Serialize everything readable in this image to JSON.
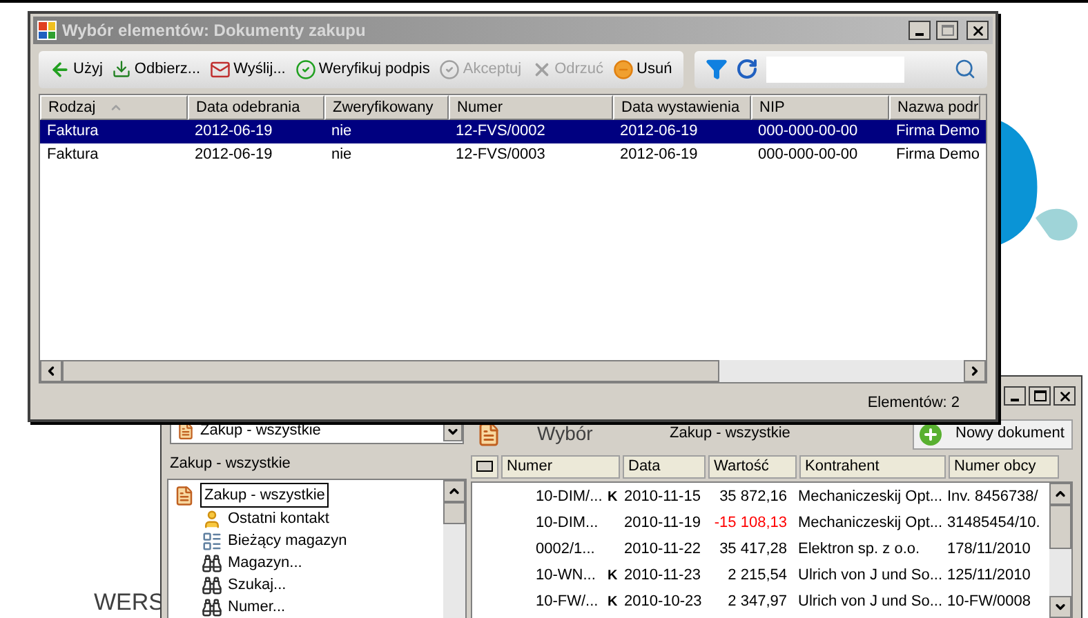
{
  "desktop": {
    "text": "WERS"
  },
  "dialog": {
    "title": "Wybór elementów: Dokumenty zakupu",
    "toolbar": [
      {
        "kind": "use",
        "label": "Użyj",
        "disabled": false
      },
      {
        "kind": "receive",
        "label": "Odbierz...",
        "disabled": false
      },
      {
        "kind": "send",
        "label": "Wyślij...",
        "disabled": false
      },
      {
        "kind": "verify",
        "label": "Weryfikuj podpis",
        "disabled": false
      },
      {
        "kind": "accept",
        "label": "Akceptuj",
        "disabled": true
      },
      {
        "kind": "reject",
        "label": "Odrzuć",
        "disabled": true
      },
      {
        "kind": "delete",
        "label": "Usuń",
        "disabled": false
      }
    ],
    "columns": [
      "Rodzaj",
      "Data odebrania",
      "Zweryfikowany",
      "Numer",
      "Data wystawienia",
      "NIP",
      "Nazwa podr"
    ],
    "rows": [
      {
        "selected": true,
        "cells": [
          "Faktura",
          "2012-06-19",
          "nie",
          "12-FVS/0002",
          "2012-06-19",
          "000-000-00-00",
          "Firma Demo"
        ]
      },
      {
        "selected": false,
        "cells": [
          "Faktura",
          "2012-06-19",
          "nie",
          "12-FVS/0003",
          "2012-06-19",
          "000-000-00-00",
          "Firma Demo"
        ]
      }
    ],
    "status_bar": "Elementów: 2"
  },
  "main_window": {
    "dropdown": "Zakup - wszystkie",
    "panel_label": "Zakup - wszystkie",
    "tree": [
      {
        "label": "Zakup - wszystkie",
        "selected": true,
        "kind": "list",
        "children": [
          {
            "label": "Ostatni kontakt",
            "selected": false,
            "kind": "contact"
          },
          {
            "label": "Bieżący magazyn",
            "selected": false,
            "kind": "stock"
          },
          {
            "label": "Magazyn...",
            "selected": false,
            "kind": "find"
          },
          {
            "label": "Szukaj...",
            "selected": false,
            "kind": "find"
          },
          {
            "label": "Numer...",
            "selected": false,
            "kind": "find"
          }
        ]
      }
    ],
    "view_label": "Wybór",
    "filter_label": "Zakup - wszystkie",
    "new_button": "Nowy dokument",
    "columns": [
      "Numer",
      "Data",
      "Wartość",
      "Kontrahent",
      "Numer obcy"
    ],
    "rows": [
      {
        "numer": "10-DIM/...",
        "mark": "K",
        "data": "2010-11-15",
        "wartosc": "35 872,16",
        "negative": false,
        "kontrahent": "Mechaniczeskij Opt...",
        "numer_obcy": "Inv. 8456738/"
      },
      {
        "numer": "10-DIM...",
        "data": "2010-11-19",
        "wartosc": "-15 108,13",
        "negative": true,
        "kontrahent": "Mechaniczeskij Opt...",
        "numer_obcy": "31485454/10."
      },
      {
        "numer": "0002/1...",
        "data": "2010-11-22",
        "wartosc": "35 417,28",
        "negative": false,
        "kontrahent": "Elektron sp. z o.o.",
        "numer_obcy": "178/11/2010"
      },
      {
        "numer": "10-WN...",
        "mark": "K",
        "data": "2010-11-23",
        "wartosc": "2 215,54",
        "negative": false,
        "kontrahent": "Ulrich von J und So...",
        "numer_obcy": "125/11/2010"
      },
      {
        "numer": "10-FW/...",
        "mark": "K",
        "data": "2010-10-23",
        "wartosc": "2 347,97",
        "negative": false,
        "kontrahent": "Ulrich von J und So...",
        "numer_obcy": "10-FW/0008"
      }
    ]
  }
}
